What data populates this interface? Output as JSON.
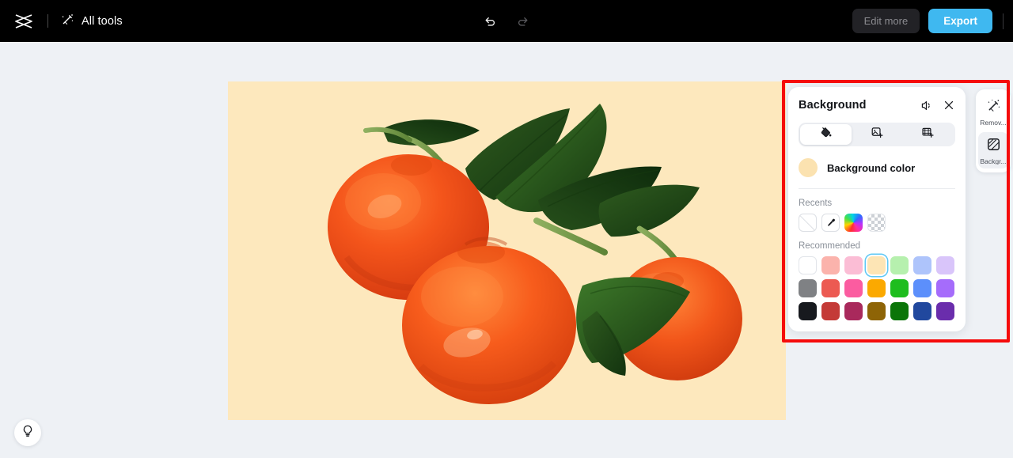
{
  "app": {
    "logo_icon": "capcut-logo-icon",
    "all_tools_label": "All tools",
    "all_tools_icon": "magic-wand-icon"
  },
  "header": {
    "undo_icon": "undo-arrow-icon",
    "redo_icon": "redo-arrow-icon",
    "edit_more_label": "Edit more",
    "export_label": "Export"
  },
  "canvas": {
    "background_color": "#FDE8BD",
    "artwork_alt": "three mandarin oranges with green leaves"
  },
  "toolrail": {
    "items": [
      {
        "label": "Remov...",
        "icon": "magic-wand-remove-icon",
        "active": false
      },
      {
        "label": "Backgr...",
        "icon": "background-swatch-icon",
        "active": true
      }
    ]
  },
  "panel": {
    "title": "Background",
    "apply_all_icon": "apply-to-all-icon",
    "close_icon": "close-icon",
    "tabs": [
      {
        "icon": "paint-bucket-icon",
        "active": true
      },
      {
        "icon": "image-add-icon",
        "active": false
      },
      {
        "icon": "video-add-icon",
        "active": false
      }
    ],
    "background_color_label": "Background color",
    "background_color_value": "#FBE2B0",
    "recents_label": "Recents",
    "recents": [
      {
        "name": "none-swatch",
        "type": "none"
      },
      {
        "name": "eyedropper-swatch",
        "type": "eyedropper"
      },
      {
        "name": "gradient-swatch",
        "type": "rainbow"
      },
      {
        "name": "transparent-swatch",
        "type": "transparent"
      }
    ],
    "recommended_label": "Recommended",
    "recommended": [
      {
        "color": "#FFFFFF",
        "selected": false,
        "is_white": true
      },
      {
        "color": "#FBB3AC",
        "selected": false
      },
      {
        "color": "#FBBDD5",
        "selected": false
      },
      {
        "color": "#FDE5B5",
        "selected": true
      },
      {
        "color": "#B6F0AE",
        "selected": false
      },
      {
        "color": "#AEC4FB",
        "selected": false
      },
      {
        "color": "#D9C5FA",
        "selected": false
      },
      {
        "color": "#7F8184",
        "selected": false
      },
      {
        "color": "#EC5A52",
        "selected": false
      },
      {
        "color": "#FB5CA0",
        "selected": false
      },
      {
        "color": "#FBA900",
        "selected": false
      },
      {
        "color": "#1EBD1E",
        "selected": false
      },
      {
        "color": "#5C8FFB",
        "selected": false
      },
      {
        "color": "#A56CFB",
        "selected": false
      },
      {
        "color": "#17191E",
        "selected": false
      },
      {
        "color": "#C43A37",
        "selected": false
      },
      {
        "color": "#A9295C",
        "selected": false
      },
      {
        "color": "#8E6406",
        "selected": false
      },
      {
        "color": "#0B7508",
        "selected": false
      },
      {
        "color": "#21489E",
        "selected": false
      },
      {
        "color": "#6A2DAC",
        "selected": false
      }
    ]
  },
  "help": {
    "icon": "lightbulb-icon"
  },
  "annotation": {
    "color": "#F50B0B"
  }
}
